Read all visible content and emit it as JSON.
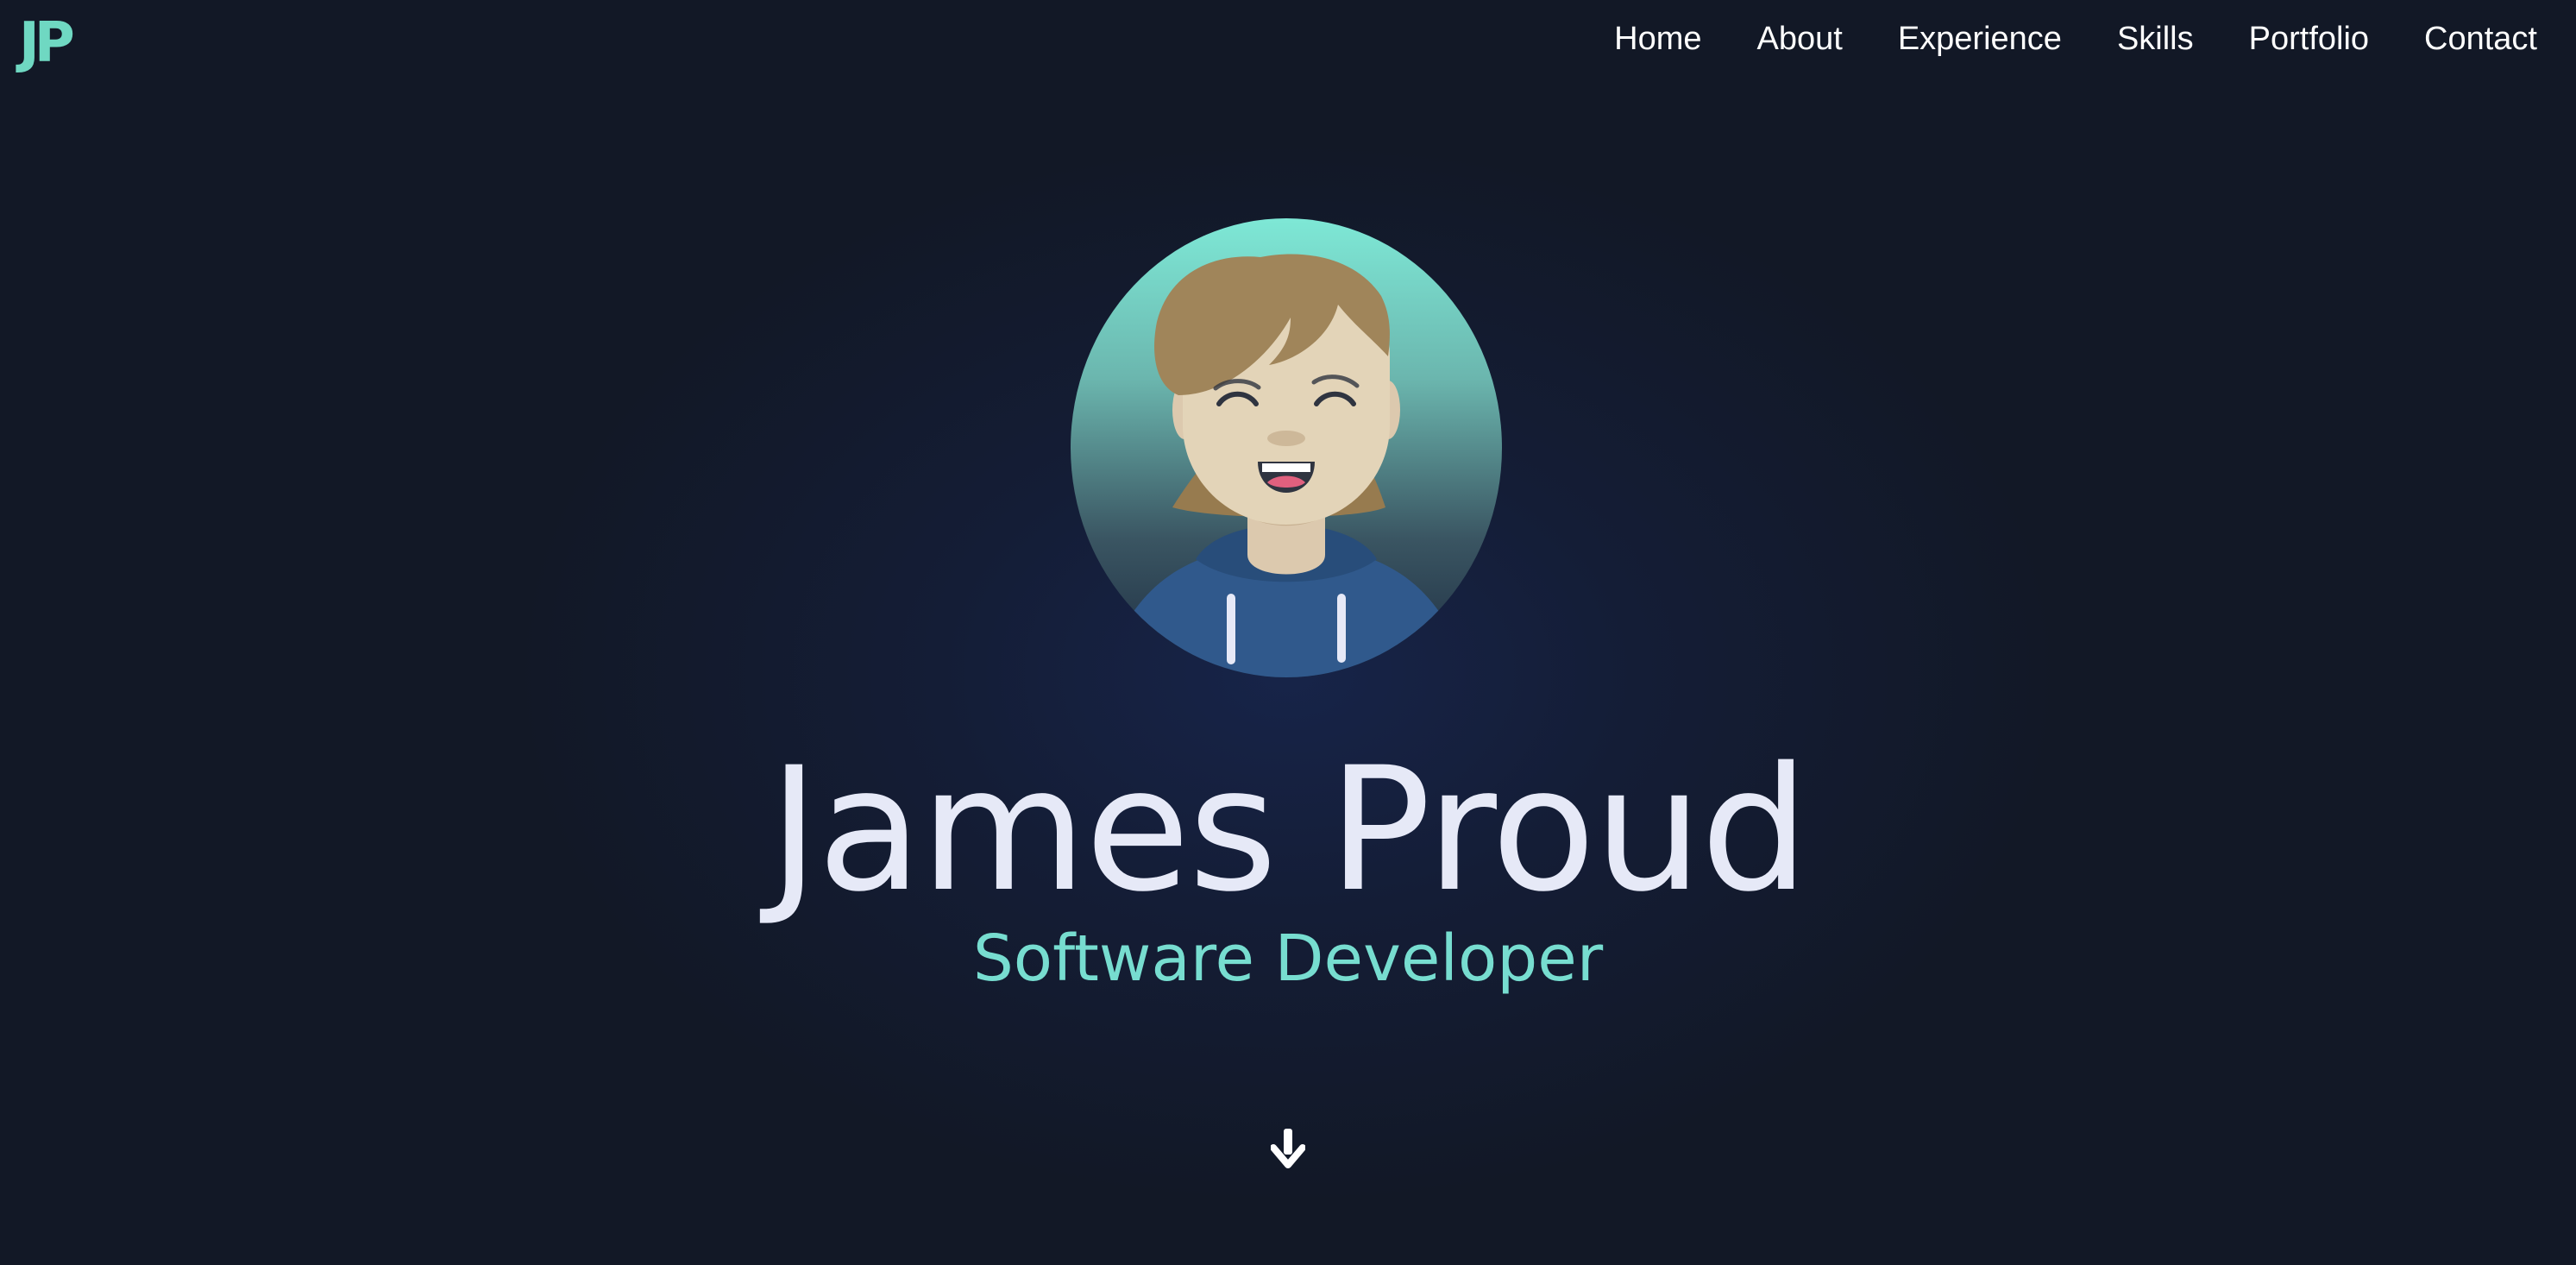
{
  "logo": {
    "text": "JP"
  },
  "nav": {
    "items": [
      {
        "label": "Home"
      },
      {
        "label": "About"
      },
      {
        "label": "Experience"
      },
      {
        "label": "Skills"
      },
      {
        "label": "Portfolio"
      },
      {
        "label": "Contact"
      }
    ]
  },
  "hero": {
    "avatar_icon": "cartoon-avatar-smiling",
    "name": "James Proud",
    "role": "Software Developer",
    "scroll_icon": "arrow-down-icon"
  },
  "colors": {
    "background": "#121826",
    "accent": "#6fd8c2",
    "name_text": "#e6e9f7",
    "role_text": "#77ddd0"
  }
}
